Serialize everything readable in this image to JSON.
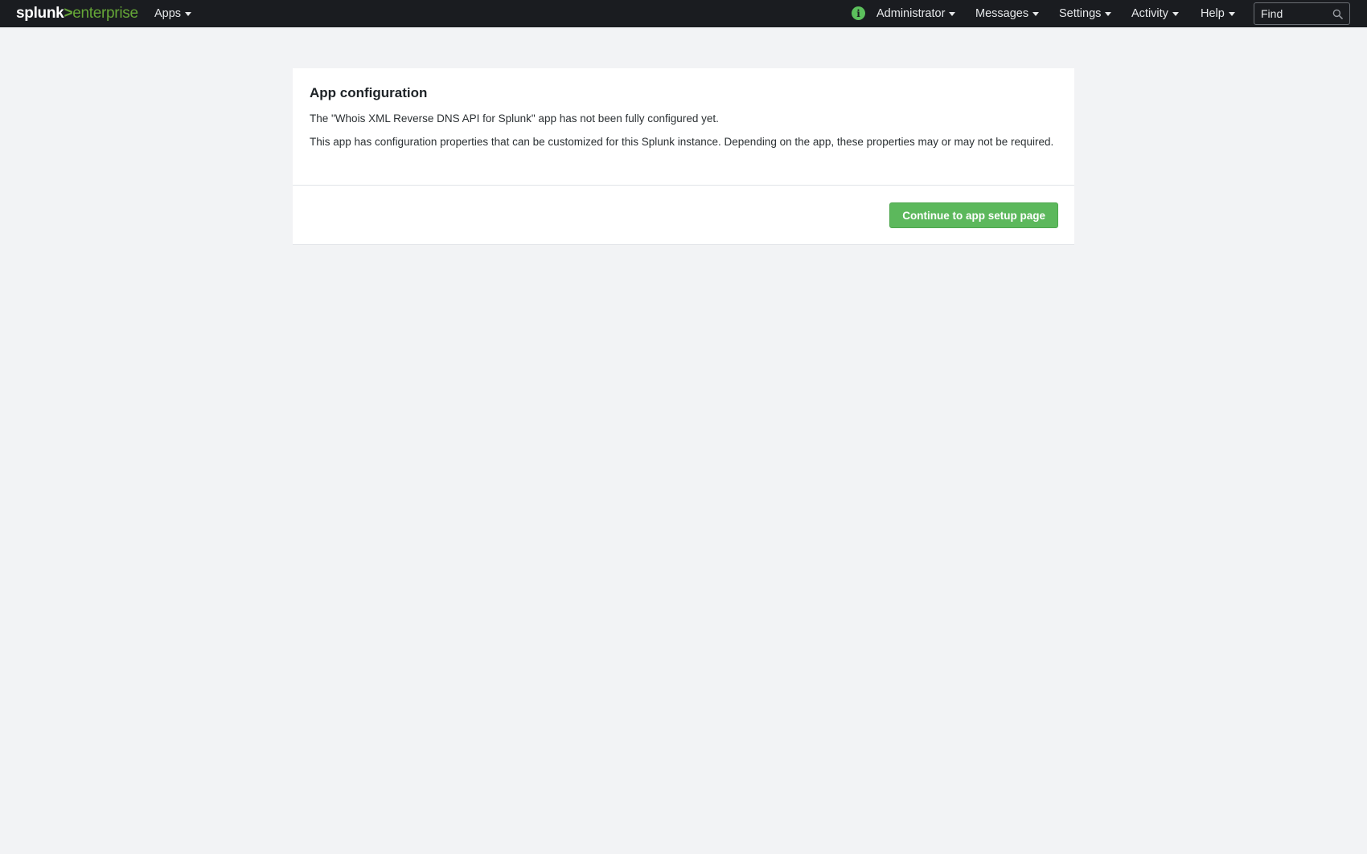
{
  "header": {
    "logo": {
      "brand": "splunk",
      "separator": ">",
      "product": "enterprise"
    },
    "apps_label": "Apps",
    "info_icon": "info-icon",
    "user_menu_label": "Administrator",
    "messages_label": "Messages",
    "settings_label": "Settings",
    "activity_label": "Activity",
    "help_label": "Help",
    "search": {
      "placeholder": "Find",
      "value": "",
      "icon": "search-icon"
    }
  },
  "panel": {
    "title": "App configuration",
    "message": "The \"Whois XML Reverse DNS API for Splunk\" app has not been fully configured yet.",
    "description": "This app has configuration properties that can be customized for this Splunk instance. Depending on the app, these properties may or may not be required.",
    "continue_label": "Continue to app setup page"
  },
  "colors": {
    "topbar_background": "#1a1c20",
    "brand_green": "#65a637",
    "button_green": "#5cb85c",
    "page_background": "#f2f3f5",
    "panel_background": "#ffffff"
  }
}
